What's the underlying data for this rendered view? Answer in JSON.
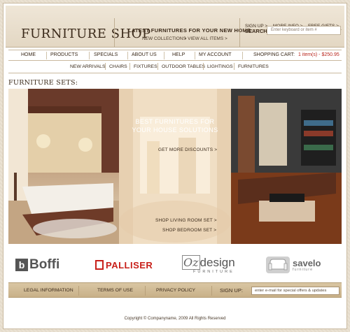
{
  "header": {
    "logo": "FURNITURE SHOP",
    "tagline": "LATEST FURNITURES FOR YOUR NEW HOME",
    "new_collections": "NEW COLLECTIONS",
    "view_all": "VIEW ALL ITEMS >",
    "sign_up": "SIGN UP >",
    "more_info": "MORE INFO >",
    "free_gifts": "FREE GIFTS >",
    "search_label": "SEARCH",
    "search_placeholder": "Enter keyboard or item #"
  },
  "nav": {
    "items": [
      "HOME",
      "PRODUCTS",
      "SPECIALS",
      "ABOUT US",
      "HELP",
      "MY ACCOUNT"
    ],
    "cart_label": "SHOPPING CART:",
    "cart_value": "1 item(s) - $250.95"
  },
  "subnav": [
    "NEW ARRIVALS",
    "CHAIRS",
    "FIXTURES",
    "OUTDOOR TABLES",
    "LIGHTINGS",
    "FURNITURES"
  ],
  "section_title": "FURNITURE SETS:",
  "hero": {
    "title_line1": "BEST FURNITURES FOR",
    "title_line2": "YOUR HOUSE SOLUTIONS",
    "get_discounts": "GET MORE DISCOUNTS >",
    "shop_living": "SHOP LIVING ROOM SET >",
    "shop_bedroom": "SHOP BEDROOM SET >"
  },
  "brands": {
    "boffi": "Boffi",
    "palliser": "PALLISER",
    "oz_design": "design",
    "oz_mark": "Oz",
    "oz_sub": "FURNITURE",
    "savelo": "savelo",
    "savelo_sub": "furniture"
  },
  "footer": {
    "links": [
      "LEGAL INFORMATION",
      "TERMS OF USE",
      "PRIVACY POLICY"
    ],
    "signup_label": "SIGN UP:",
    "signup_placeholder": "enter e-mail for special offers & updates",
    "copyright": "Copyright © Companyname, 2009 All Rights Reserved"
  },
  "colors": {
    "accent": "#b8241b",
    "header_bg": "#e3d7c3",
    "footer_bg": "#c8b088"
  }
}
